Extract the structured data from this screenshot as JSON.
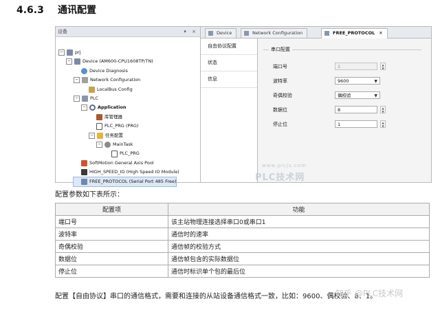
{
  "heading": {
    "number": "4.6.3",
    "title": "通讯配置"
  },
  "devices_panel": {
    "title": "设备",
    "controls": "▾ ⨯",
    "tree": [
      {
        "label": "prj",
        "level": 0,
        "expander": "⊟",
        "icon": "project-icon"
      },
      {
        "label": "Device (AM600-CPU1608TP/TN)",
        "level": 1,
        "expander": "⊟",
        "icon": "device-icon"
      },
      {
        "label": "Device Diagnosis",
        "level": 2,
        "expander": "",
        "icon": "diagnosis-icon"
      },
      {
        "label": "Network Configuration",
        "level": 2,
        "expander": "⊟",
        "icon": "network-config-icon"
      },
      {
        "label": "LocalBus Config",
        "level": 3,
        "expander": "",
        "icon": "localbus-icon"
      },
      {
        "label": "PLC",
        "level": 2,
        "expander": "⊟",
        "icon": "plc-icon"
      },
      {
        "label": "Application",
        "level": 3,
        "expander": "⊟",
        "icon": "application-icon",
        "bold": true
      },
      {
        "label": "库管理器",
        "level": 4,
        "expander": "",
        "icon": "library-manager-icon"
      },
      {
        "label": "PLC_PRG (PRG)",
        "level": 4,
        "expander": "",
        "icon": "program-icon"
      },
      {
        "label": "任务配置",
        "level": 4,
        "expander": "⊟",
        "icon": "task-config-icon"
      },
      {
        "label": "MainTask",
        "level": 5,
        "expander": "⊟",
        "icon": "task-icon"
      },
      {
        "label": "PLC_PRG",
        "level": 6,
        "expander": "",
        "icon": "program-icon"
      },
      {
        "label": "SoftMotion General Axis Pool",
        "level": 2,
        "expander": "",
        "icon": "softmotion-icon"
      },
      {
        "label": "HIGH_SPEED_IO (High Speed IO Module)",
        "level": 2,
        "expander": "",
        "icon": "io-module-icon"
      },
      {
        "label": "FREE_PROTOCOL (Serial Port 485 Free)",
        "level": 2,
        "expander": "",
        "icon": "free-protocol-icon",
        "selected": true
      }
    ]
  },
  "editor": {
    "tabs": [
      {
        "label": "Device",
        "active": false
      },
      {
        "label": "Network Configuration",
        "active": false
      },
      {
        "label": "FREE_PROTOCOL",
        "active": true,
        "close": "✕"
      }
    ],
    "side_tabs": [
      "自由协议配置",
      "状态",
      "信息"
    ],
    "group_title": "串口配置",
    "fields": [
      {
        "label": "端口号",
        "value": "1",
        "kind": "spin",
        "disabled": true
      },
      {
        "label": "波特率",
        "value": "9600",
        "kind": "select"
      },
      {
        "label": "奇偶校验",
        "value": "偶校验",
        "kind": "select"
      },
      {
        "label": "数据位",
        "value": "8",
        "kind": "spin"
      },
      {
        "label": "停止位",
        "value": "1",
        "kind": "spin"
      }
    ],
    "watermark_url": "www.plcjs.com",
    "watermark": "PLC技术网"
  },
  "intro": "配置参数如下表所示：",
  "table": {
    "headers": [
      "配置项",
      "功能"
    ],
    "rows": [
      [
        "端口号",
        "该主站物理连接选择串口0或串口1"
      ],
      [
        "波特率",
        "通信时的速率"
      ],
      [
        "奇偶校验",
        "通信帧的校验方式"
      ],
      [
        "数据位",
        "通信帧包含的实际数据位"
      ],
      [
        "停止位",
        "通信时标识单个包的最后位"
      ]
    ]
  },
  "footer_text": "配置【自由协议】串口的通信格式，需要和连接的从站设备通信格式一致，比如：9600、偶校验、8、1。",
  "credit": "知乎 @PLC技术网"
}
